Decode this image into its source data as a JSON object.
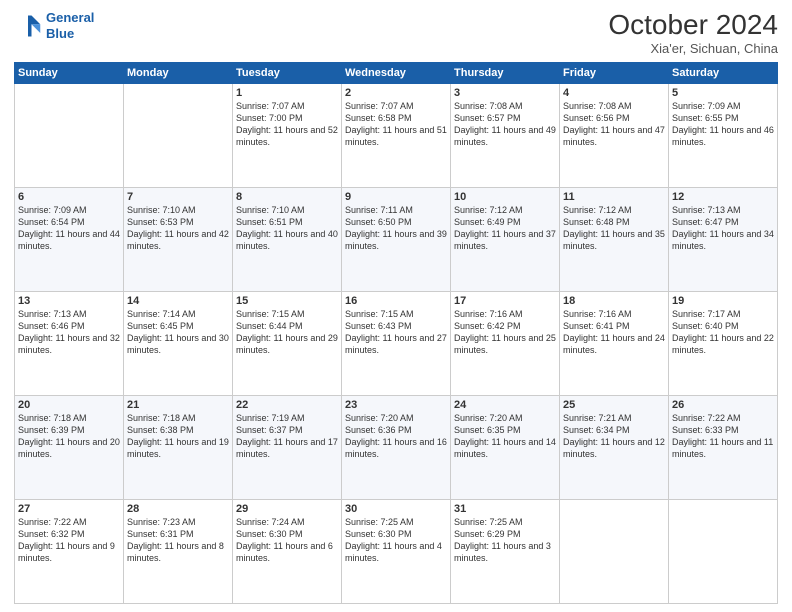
{
  "header": {
    "logo_line1": "General",
    "logo_line2": "Blue",
    "title": "October 2024",
    "subtitle": "Xia'er, Sichuan, China"
  },
  "weekdays": [
    "Sunday",
    "Monday",
    "Tuesday",
    "Wednesday",
    "Thursday",
    "Friday",
    "Saturday"
  ],
  "weeks": [
    [
      {
        "day": "",
        "detail": ""
      },
      {
        "day": "",
        "detail": ""
      },
      {
        "day": "1",
        "detail": "Sunrise: 7:07 AM\nSunset: 7:00 PM\nDaylight: 11 hours and 52 minutes."
      },
      {
        "day": "2",
        "detail": "Sunrise: 7:07 AM\nSunset: 6:58 PM\nDaylight: 11 hours and 51 minutes."
      },
      {
        "day": "3",
        "detail": "Sunrise: 7:08 AM\nSunset: 6:57 PM\nDaylight: 11 hours and 49 minutes."
      },
      {
        "day": "4",
        "detail": "Sunrise: 7:08 AM\nSunset: 6:56 PM\nDaylight: 11 hours and 47 minutes."
      },
      {
        "day": "5",
        "detail": "Sunrise: 7:09 AM\nSunset: 6:55 PM\nDaylight: 11 hours and 46 minutes."
      }
    ],
    [
      {
        "day": "6",
        "detail": "Sunrise: 7:09 AM\nSunset: 6:54 PM\nDaylight: 11 hours and 44 minutes."
      },
      {
        "day": "7",
        "detail": "Sunrise: 7:10 AM\nSunset: 6:53 PM\nDaylight: 11 hours and 42 minutes."
      },
      {
        "day": "8",
        "detail": "Sunrise: 7:10 AM\nSunset: 6:51 PM\nDaylight: 11 hours and 40 minutes."
      },
      {
        "day": "9",
        "detail": "Sunrise: 7:11 AM\nSunset: 6:50 PM\nDaylight: 11 hours and 39 minutes."
      },
      {
        "day": "10",
        "detail": "Sunrise: 7:12 AM\nSunset: 6:49 PM\nDaylight: 11 hours and 37 minutes."
      },
      {
        "day": "11",
        "detail": "Sunrise: 7:12 AM\nSunset: 6:48 PM\nDaylight: 11 hours and 35 minutes."
      },
      {
        "day": "12",
        "detail": "Sunrise: 7:13 AM\nSunset: 6:47 PM\nDaylight: 11 hours and 34 minutes."
      }
    ],
    [
      {
        "day": "13",
        "detail": "Sunrise: 7:13 AM\nSunset: 6:46 PM\nDaylight: 11 hours and 32 minutes."
      },
      {
        "day": "14",
        "detail": "Sunrise: 7:14 AM\nSunset: 6:45 PM\nDaylight: 11 hours and 30 minutes."
      },
      {
        "day": "15",
        "detail": "Sunrise: 7:15 AM\nSunset: 6:44 PM\nDaylight: 11 hours and 29 minutes."
      },
      {
        "day": "16",
        "detail": "Sunrise: 7:15 AM\nSunset: 6:43 PM\nDaylight: 11 hours and 27 minutes."
      },
      {
        "day": "17",
        "detail": "Sunrise: 7:16 AM\nSunset: 6:42 PM\nDaylight: 11 hours and 25 minutes."
      },
      {
        "day": "18",
        "detail": "Sunrise: 7:16 AM\nSunset: 6:41 PM\nDaylight: 11 hours and 24 minutes."
      },
      {
        "day": "19",
        "detail": "Sunrise: 7:17 AM\nSunset: 6:40 PM\nDaylight: 11 hours and 22 minutes."
      }
    ],
    [
      {
        "day": "20",
        "detail": "Sunrise: 7:18 AM\nSunset: 6:39 PM\nDaylight: 11 hours and 20 minutes."
      },
      {
        "day": "21",
        "detail": "Sunrise: 7:18 AM\nSunset: 6:38 PM\nDaylight: 11 hours and 19 minutes."
      },
      {
        "day": "22",
        "detail": "Sunrise: 7:19 AM\nSunset: 6:37 PM\nDaylight: 11 hours and 17 minutes."
      },
      {
        "day": "23",
        "detail": "Sunrise: 7:20 AM\nSunset: 6:36 PM\nDaylight: 11 hours and 16 minutes."
      },
      {
        "day": "24",
        "detail": "Sunrise: 7:20 AM\nSunset: 6:35 PM\nDaylight: 11 hours and 14 minutes."
      },
      {
        "day": "25",
        "detail": "Sunrise: 7:21 AM\nSunset: 6:34 PM\nDaylight: 11 hours and 12 minutes."
      },
      {
        "day": "26",
        "detail": "Sunrise: 7:22 AM\nSunset: 6:33 PM\nDaylight: 11 hours and 11 minutes."
      }
    ],
    [
      {
        "day": "27",
        "detail": "Sunrise: 7:22 AM\nSunset: 6:32 PM\nDaylight: 11 hours and 9 minutes."
      },
      {
        "day": "28",
        "detail": "Sunrise: 7:23 AM\nSunset: 6:31 PM\nDaylight: 11 hours and 8 minutes."
      },
      {
        "day": "29",
        "detail": "Sunrise: 7:24 AM\nSunset: 6:30 PM\nDaylight: 11 hours and 6 minutes."
      },
      {
        "day": "30",
        "detail": "Sunrise: 7:25 AM\nSunset: 6:30 PM\nDaylight: 11 hours and 4 minutes."
      },
      {
        "day": "31",
        "detail": "Sunrise: 7:25 AM\nSunset: 6:29 PM\nDaylight: 11 hours and 3 minutes."
      },
      {
        "day": "",
        "detail": ""
      },
      {
        "day": "",
        "detail": ""
      }
    ]
  ]
}
